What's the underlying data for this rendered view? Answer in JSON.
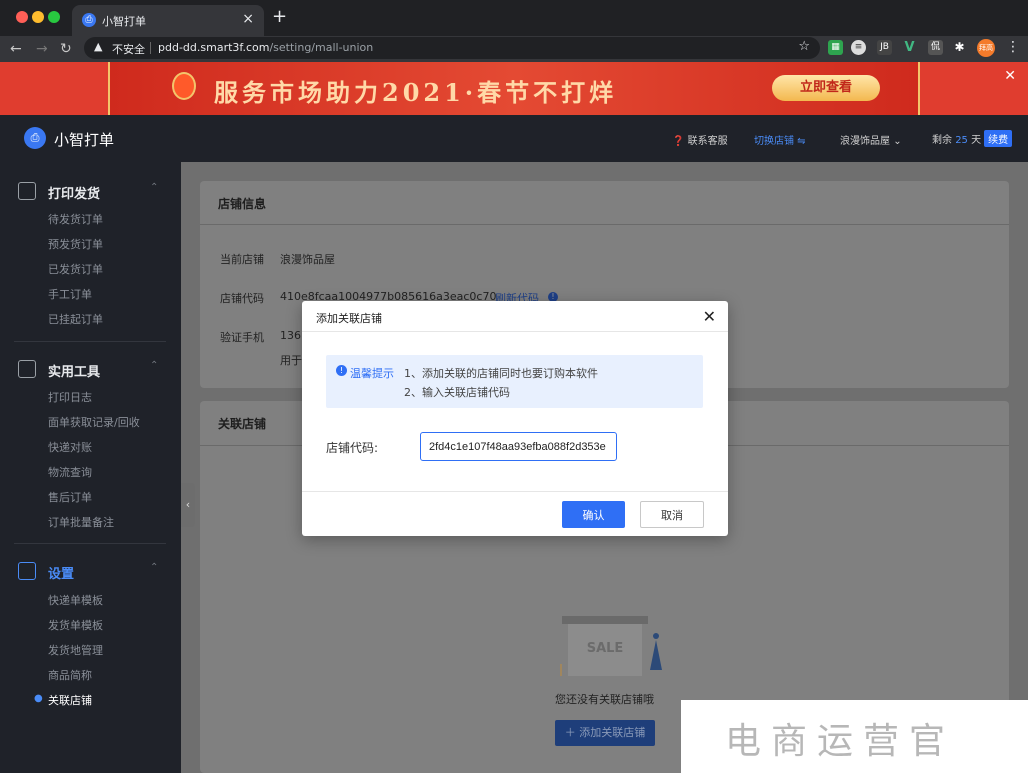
{
  "browser": {
    "tab_title": "小智打单",
    "security_label": "不安全",
    "url_host": "pdd-dd.smart3f.com",
    "url_path": "/setting/mall-union",
    "profile_label": "拜高"
  },
  "banner": {
    "text": "服务市场助力2021·春节不打烊",
    "cta": "立即查看"
  },
  "app": {
    "name": "小智打单",
    "header": {
      "support": "联系客服",
      "switch_store": "切换店铺 ⇋",
      "current_store": "浪漫饰品屋",
      "remaining_prefix": "剩余",
      "remaining_days": "25",
      "remaining_unit": "天",
      "renew": "续费"
    }
  },
  "sidebar": {
    "sections": [
      {
        "label": "打印发货",
        "items": [
          "待发货订单",
          "预发货订单",
          "已发货订单",
          "手工订单",
          "已挂起订单"
        ]
      },
      {
        "label": "实用工具",
        "items": [
          "打印日志",
          "面单获取记录/回收",
          "快递对账",
          "物流查询",
          "售后订单",
          "订单批量备注"
        ]
      },
      {
        "label": "设置",
        "items": [
          "快递单模板",
          "发货单模板",
          "发货地管理",
          "商品简称",
          "关联店铺"
        ]
      }
    ]
  },
  "store_info": {
    "title": "店铺信息",
    "current_store_label": "当前店铺",
    "current_store_value": "浪漫饰品屋",
    "code_label": "店铺代码",
    "code_value": "410e8fcaa1004977b085616a3eac0c70",
    "refresh_link": "刷新代码",
    "phone_label": "验证手机",
    "phone_value": "136",
    "note_fragment": "用于"
  },
  "linked": {
    "title": "关联店铺",
    "sale_sign": "SALE",
    "empty_text": "您还没有关联店铺哦",
    "add_button": "＋ 添加关联店铺"
  },
  "modal": {
    "title": "添加关联店铺",
    "tip_head": "温馨提示",
    "tip_line1": "1、添加关联的店铺同时也要订购本软件",
    "tip_line2": "2、输入关联店铺代码",
    "code_label": "店铺代码:",
    "code_value": "2fd4c1e107f48aa93efba088f2d353e",
    "confirm": "确认",
    "cancel": "取消"
  },
  "watermark": {
    "text": "电商运营官"
  },
  "colors": {
    "primary": "#2f6ff5",
    "banner": "#e03d2f",
    "sidebar": "#1f2229"
  }
}
